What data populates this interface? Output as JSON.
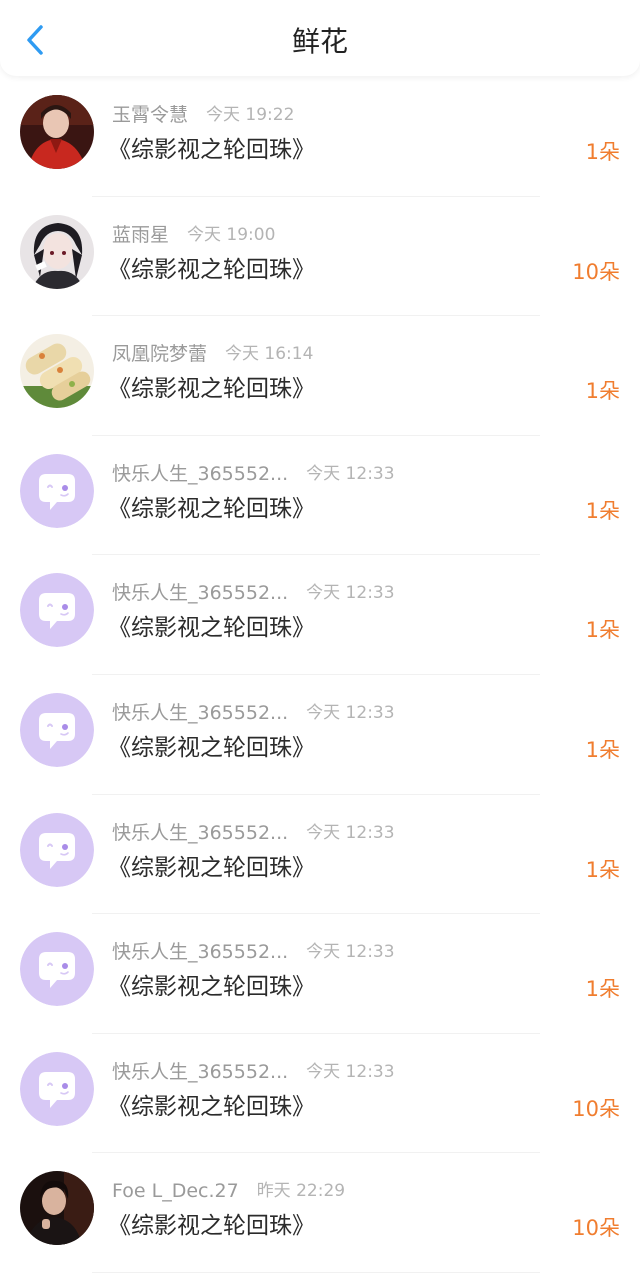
{
  "header": {
    "title": "鲜花",
    "back_icon": "chevron-left-icon",
    "accent_color": "#2f9bf2"
  },
  "colors": {
    "count": "#f07d2f",
    "default_avatar_bg": "#d7c8f5",
    "default_avatar_bubble": "#ffffff"
  },
  "items": [
    {
      "user": "玉霄令慧",
      "time": "今天 19:22",
      "book": "《综影视之轮回珠》",
      "count": "1朵",
      "avatar": "photo-red-robe"
    },
    {
      "user": "蓝雨星",
      "time": "今天 19:00",
      "book": "《综影视之轮回珠》",
      "count": "10朵",
      "avatar": "photo-dark-hair"
    },
    {
      "user": "凤凰院梦蕾",
      "time": "今天 16:14",
      "book": "《综影视之轮回珠》",
      "count": "1朵",
      "avatar": "photo-spring-rolls"
    },
    {
      "user": "快乐人生_365552...",
      "time": "今天 12:33",
      "book": "《综影视之轮回珠》",
      "count": "1朵",
      "avatar": "default-bubble"
    },
    {
      "user": "快乐人生_365552...",
      "time": "今天 12:33",
      "book": "《综影视之轮回珠》",
      "count": "1朵",
      "avatar": "default-bubble"
    },
    {
      "user": "快乐人生_365552...",
      "time": "今天 12:33",
      "book": "《综影视之轮回珠》",
      "count": "1朵",
      "avatar": "default-bubble"
    },
    {
      "user": "快乐人生_365552...",
      "time": "今天 12:33",
      "book": "《综影视之轮回珠》",
      "count": "1朵",
      "avatar": "default-bubble"
    },
    {
      "user": "快乐人生_365552...",
      "time": "今天 12:33",
      "book": "《综影视之轮回珠》",
      "count": "1朵",
      "avatar": "default-bubble"
    },
    {
      "user": "快乐人生_365552...",
      "time": "今天 12:33",
      "book": "《综影视之轮回珠》",
      "count": "10朵",
      "avatar": "default-bubble"
    },
    {
      "user": "Foe L_Dec.27",
      "time": "昨天 22:29",
      "book": "《综影视之轮回珠》",
      "count": "10朵",
      "avatar": "photo-dark-portrait"
    }
  ]
}
